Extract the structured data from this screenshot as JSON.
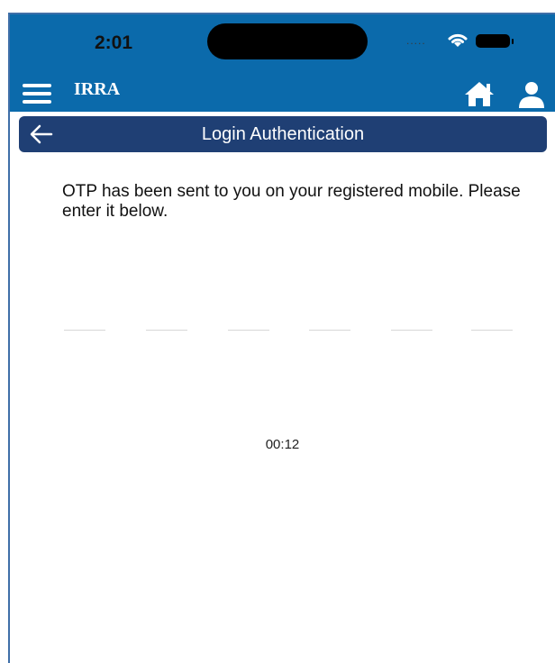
{
  "status_bar": {
    "time": "2:01",
    "signal": "....."
  },
  "app_bar": {
    "title": "IRRA",
    "menu_icon": "hamburger-menu-icon",
    "home_icon": "home-icon",
    "user_icon": "user-icon"
  },
  "header": {
    "title": "Login Authentication",
    "back_icon": "arrow-left-icon"
  },
  "main": {
    "message": "OTP has been sent to you on your registered mobile. Please enter it below.",
    "otp": {
      "digits": [
        "",
        "",
        "",
        "",
        "",
        ""
      ]
    },
    "timer": "00:12"
  },
  "colors": {
    "app_bar_bg": "#0b6aab",
    "header_bg": "#1f3f74",
    "text": "#111111"
  }
}
